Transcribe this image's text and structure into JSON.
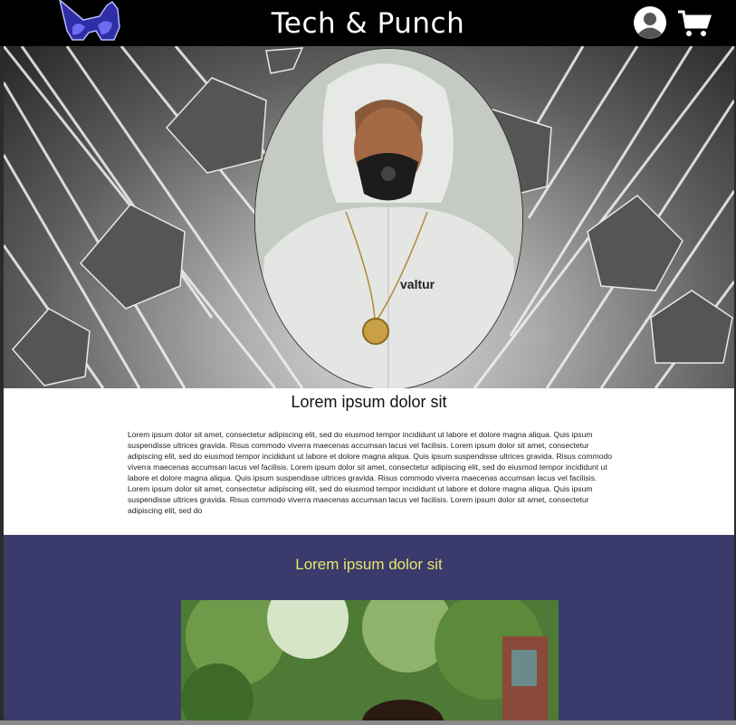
{
  "header": {
    "title": "Tech & Punch",
    "logo_icon": "mask-logo-icon",
    "user_icon": "user-account-icon",
    "cart_icon": "shopping-cart-icon"
  },
  "hero": {
    "portrait_brand": "valtur"
  },
  "intro": {
    "title": "Lorem ipsum dolor sit",
    "body": "Lorem ipsum dolor sit amet, consectetur adipiscing elit, sed do eiusmod tempor incididunt ut labore et dolore magna aliqua. Quis ipsum suspendisse ultrices gravida. Risus commodo viverra maecenas accumsan lacus vel facilisis. Lorem ipsum dolor sit amet, consectetur adipiscing elit, sed do eiusmod tempor incididunt ut labore et dolore magna aliqua. Quis ipsum suspendisse ultrices gravida. Risus commodo viverra maecenas accumsan lacus vel facilisis. Lorem ipsum dolor sit amet, consectetur adipiscing elit, sed do eiusmod tempor incididunt ut labore et dolore magna aliqua. Quis ipsum suspendisse ultrices gravida. Risus commodo viverra maecenas accumsan lacus vel facilisis. Lorem ipsum dolor sit amet, consectetur adipiscing elit, sed do eiusmod tempor incididunt ut labore et dolore magna aliqua. Quis ipsum suspendisse ultrices gravida. Risus commodo viverra maecenas accumsan lacus vel facilisis. Lorem ipsum dolor sit amet, consectetur adipiscing elit, sed do"
  },
  "feature": {
    "title": "Lorem ipsum dolor sit"
  },
  "colors": {
    "header_bg": "#000000",
    "feature_bg": "#3a3a6c",
    "feature_title": "#e9e66a",
    "logo_accent": "#3b3bb0"
  }
}
